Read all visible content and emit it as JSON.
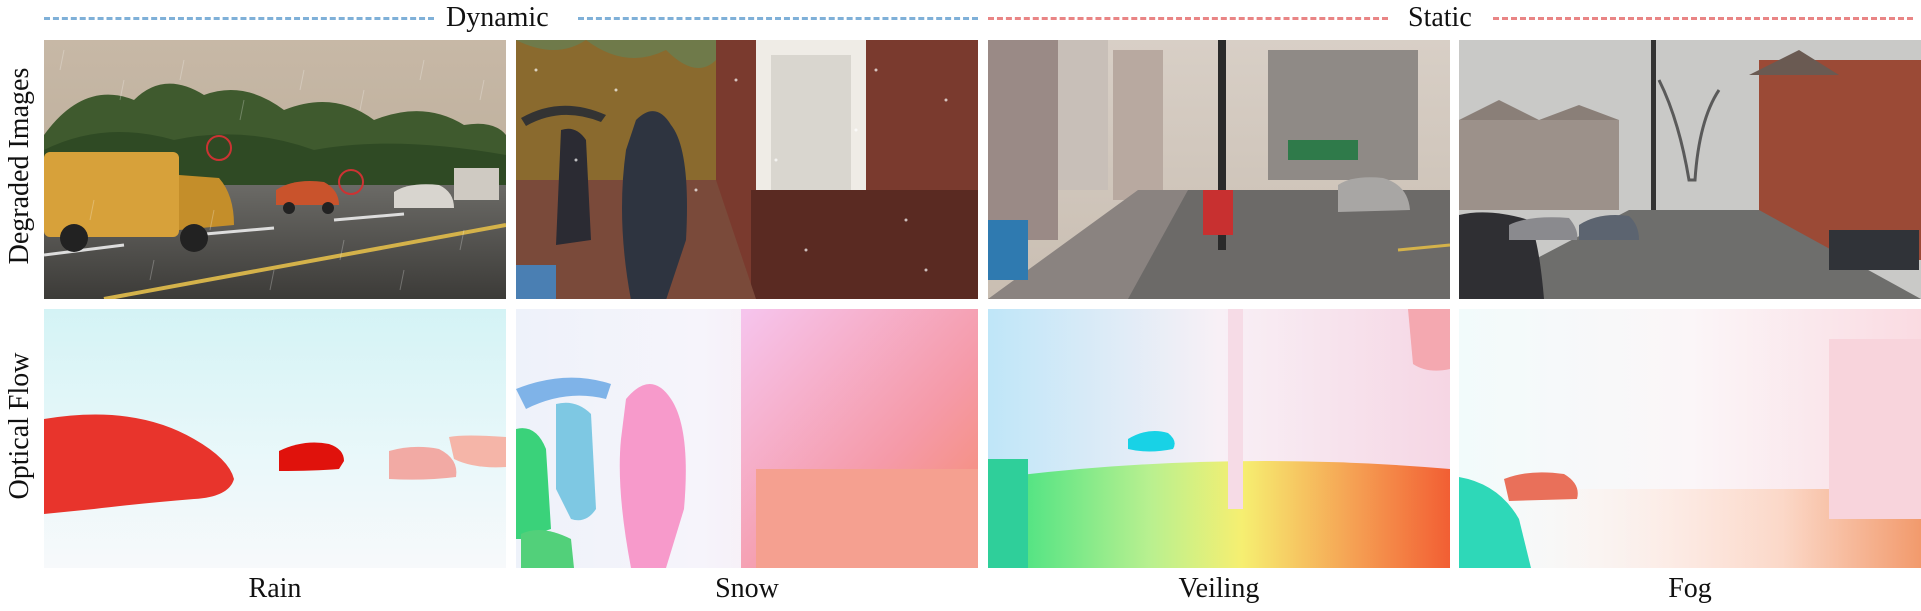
{
  "groups": {
    "dynamic": {
      "label": "Dynamic",
      "color": "#7fb0d8"
    },
    "static": {
      "label": "Static",
      "color": "#e98585"
    }
  },
  "row_labels": {
    "degraded": "Degraded Images",
    "flow": "Optical Flow"
  },
  "columns": [
    {
      "caption": "Rain"
    },
    {
      "caption": "Snow"
    },
    {
      "caption": "Veiling"
    },
    {
      "caption": "Fog"
    }
  ]
}
